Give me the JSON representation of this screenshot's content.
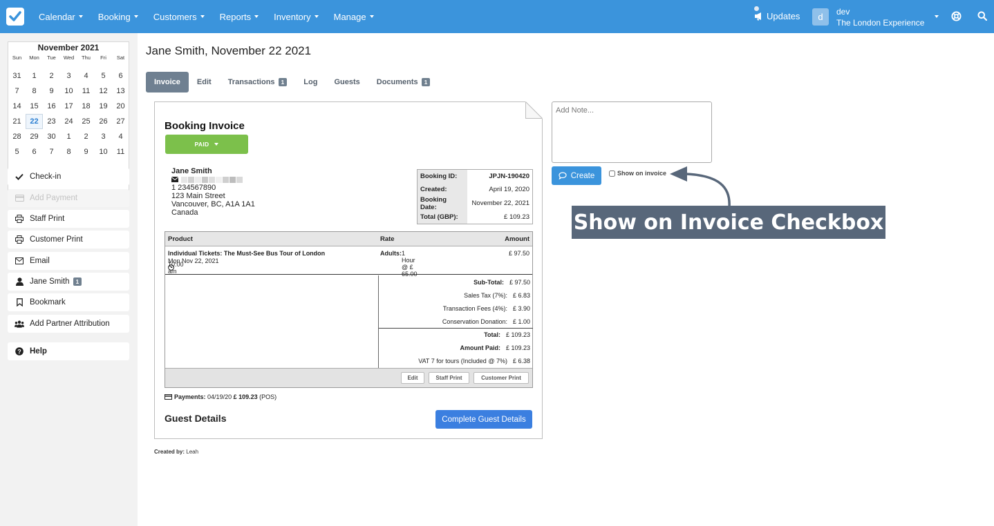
{
  "nav": {
    "items": [
      "Calendar",
      "Booking",
      "Customers",
      "Reports",
      "Inventory",
      "Manage"
    ],
    "updates": "Updates",
    "avatar_letter": "d",
    "user_name": "dev",
    "org_name": "The London Experience"
  },
  "calendar": {
    "month_label": "November 2021",
    "weekdays": [
      "Sun",
      "Mon",
      "Tue",
      "Wed",
      "Thu",
      "Fri",
      "Sat"
    ],
    "weeks": [
      [
        "31",
        "1",
        "2",
        "3",
        "4",
        "5",
        "6"
      ],
      [
        "7",
        "8",
        "9",
        "10",
        "11",
        "12",
        "13"
      ],
      [
        "14",
        "15",
        "16",
        "17",
        "18",
        "19",
        "20"
      ],
      [
        "21",
        "22",
        "23",
        "24",
        "25",
        "26",
        "27"
      ],
      [
        "28",
        "29",
        "30",
        "1",
        "2",
        "3",
        "4"
      ],
      [
        "5",
        "6",
        "7",
        "8",
        "9",
        "10",
        "11"
      ]
    ],
    "selected": "22"
  },
  "sidebar": {
    "checkin": "Check-in",
    "add_payment": "Add Payment",
    "staff_print": "Staff Print",
    "customer_print": "Customer Print",
    "email": "Email",
    "customer": "Jane Smith",
    "customer_badge": "1",
    "bookmark": "Bookmark",
    "partner": "Add Partner Attribution",
    "help": "Help"
  },
  "page": {
    "title": "Jane Smith, November 22 2021",
    "tabs": [
      {
        "label": "Invoice",
        "badge": ""
      },
      {
        "label": "Edit",
        "badge": ""
      },
      {
        "label": "Transactions",
        "badge": "1"
      },
      {
        "label": "Log",
        "badge": ""
      },
      {
        "label": "Guests",
        "badge": ""
      },
      {
        "label": "Documents",
        "badge": "1"
      }
    ]
  },
  "invoice": {
    "title": "Booking Invoice",
    "status": "PAID",
    "customer": {
      "name": "Jane Smith",
      "phone": "1 234567890",
      "street": "123 Main Street",
      "city": "Vancouver, BC, A1A 1A1",
      "country": "Canada"
    },
    "booking": {
      "id_label": "Booking ID:",
      "id": "JPJN-190420",
      "created_label": "Created:",
      "created": "April 19, 2020",
      "date_label": "Booking Date:",
      "date": "November 22, 2021",
      "total_label": "Total (GBP):",
      "total": "£ 109.23"
    },
    "headers": {
      "product": "Product",
      "rate": "Rate",
      "amount": "Amount"
    },
    "item": {
      "product": "Individual Tickets: The Must-See Bus Tour of London",
      "date": "Mon Nov 22, 2021",
      "time": "10:00 am",
      "rate_label": "Adults:",
      "rate": "1 Hour @ £ 65.00",
      "amount": "£ 97.50"
    },
    "totals": {
      "subtotal_label": "Sub-Total:",
      "subtotal": "£ 97.50",
      "tax_label": "Sales Tax (7%):",
      "tax": "£ 6.83",
      "fees_label": "Transaction Fees (4%):",
      "fees": "£ 3.90",
      "donation_label": "Conservation Donation:",
      "donation": "£ 1.00",
      "total_label": "Total:",
      "total": "£ 109.23",
      "paid_label": "Amount Paid:",
      "paid": "£ 109.23",
      "vat_label": "VAT 7 for tours (Included @ 7%)",
      "vat": "£ 6.38"
    },
    "footer_buttons": {
      "edit": "Edit",
      "staff_print": "Staff Print",
      "customer_print": "Customer Print"
    },
    "payments_label": "Payments:",
    "payments_date": "04/19/20",
    "payments_amount": "£ 109.23",
    "payments_method": "(POS)",
    "guest_details": "Guest Details",
    "complete_guest": "Complete Guest Details",
    "created_by_label": "Created by:",
    "created_by": "Leah"
  },
  "note": {
    "placeholder": "Add Note...",
    "create": "Create",
    "show_on_invoice": "Show on invoice"
  },
  "callout": "Show on Invoice Checkbox",
  "colors": {
    "topbar": "#3b94dc",
    "paid": "#7cc04b",
    "callout": "#58677a",
    "primary": "#3b7fe0"
  }
}
